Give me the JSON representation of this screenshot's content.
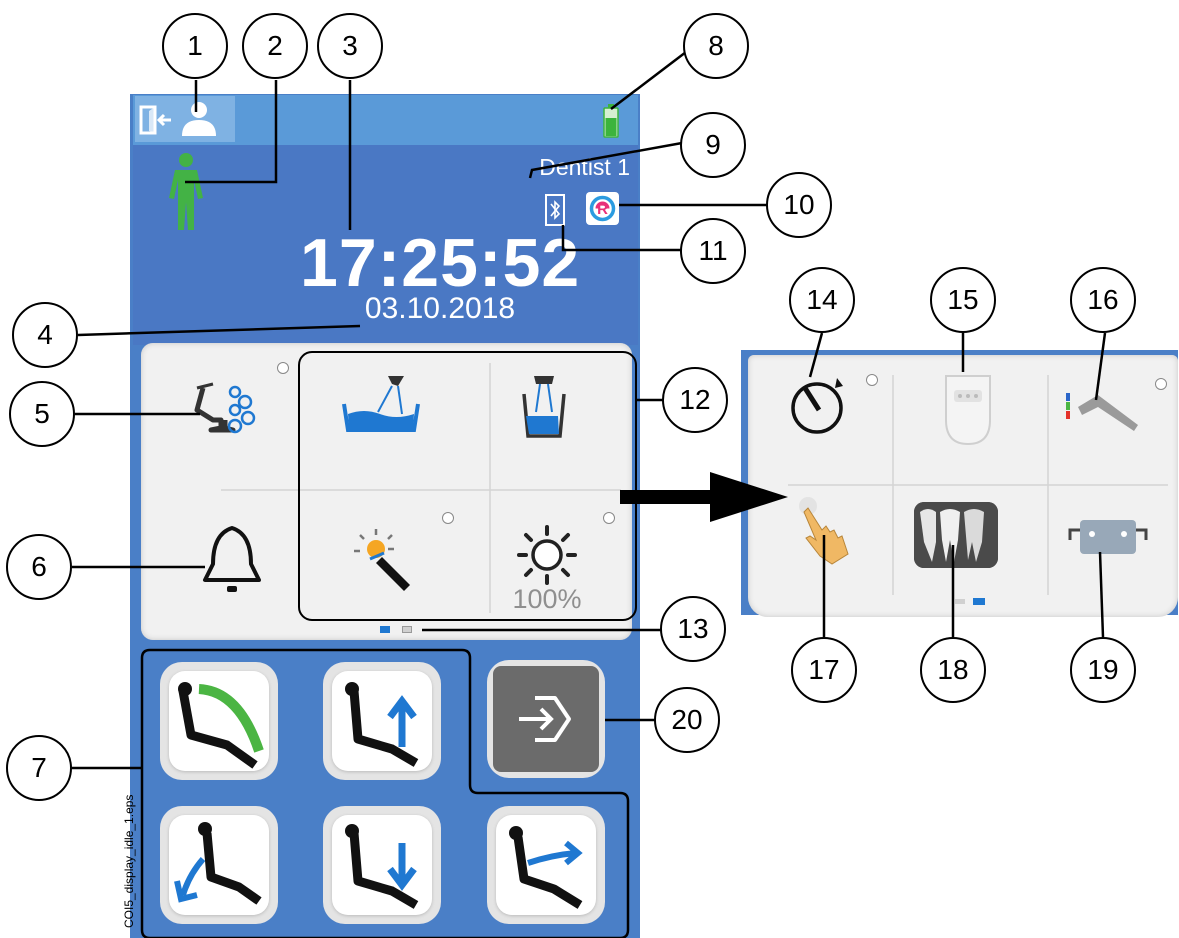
{
  "screen": {
    "operator": "Dentist 1",
    "time": "17:25:52",
    "date": "03.10.2018",
    "brightness_level": "100%",
    "battery_level": 0.6,
    "active_page": 1,
    "page_count": 2
  },
  "callouts": [
    "1",
    "2",
    "3",
    "4",
    "5",
    "6",
    "7",
    "8",
    "9",
    "10",
    "11",
    "12",
    "13",
    "14",
    "15",
    "16",
    "17",
    "18",
    "19",
    "20"
  ],
  "figure_label": "COI5_display_idle_1.eps",
  "icons": {
    "logout": "door-arrow-person-icon",
    "patient": "person-standing-icon",
    "bluetooth": "bluetooth-icon",
    "registration": "r-circle-icon",
    "cleaning": "chair-bubbles-icon",
    "bowl_rinse": "bowl-rinse-icon",
    "cup_fill": "cup-fill-icon",
    "curing_light": "curing-light-icon",
    "operating_light": "operating-light-icon",
    "call_bell": "bell-icon",
    "timer": "stopwatch-icon",
    "intraoral_camera": "intraoral-camera-icon",
    "instrument": "handpiece-icon",
    "touch": "hand-touch-icon",
    "xray": "xray-image-icon",
    "headrest": "headrest-icon",
    "enter": "enter-arrow-icon"
  },
  "colors": {
    "screen_blue": "#4a78c4",
    "topbar_blue": "#5a9ad8",
    "status_green": "#3cb43c",
    "arrow_blue": "#1f78d1"
  }
}
